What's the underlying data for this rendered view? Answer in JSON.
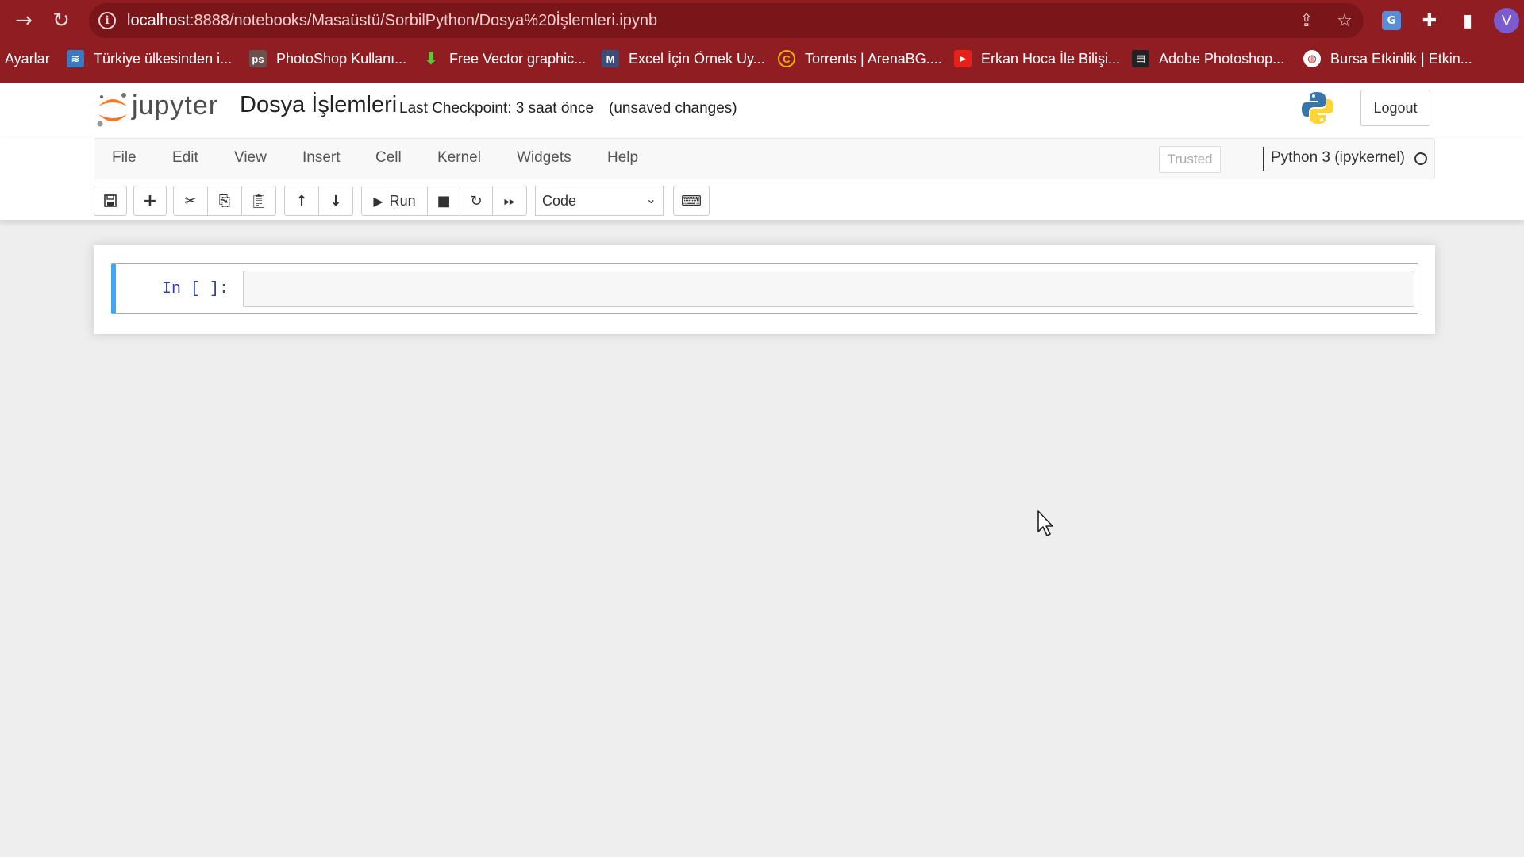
{
  "browser": {
    "url_host": "localhost",
    "url_path": ":8888/notebooks/Masaüstü/SorbilPython/Dosya%20İşlemleri.ipynb",
    "profile_initial": "V",
    "bookmarks": [
      {
        "label": "Ayarlar",
        "icon": "none"
      },
      {
        "label": "Türkiye ülkesinden i...",
        "icon": "map-icon"
      },
      {
        "label": "PhotoShop Kullanı...",
        "icon": "photoshop-icon"
      },
      {
        "label": "Free Vector graphic...",
        "icon": "download-arrow-icon"
      },
      {
        "label": "Excel İçin Örnek Uy...",
        "icon": "excel-icon"
      },
      {
        "label": "Torrents | ArenaBG....",
        "icon": "arenabg-icon"
      },
      {
        "label": "Erkan Hoca İle Bilişi...",
        "icon": "youtube-icon"
      },
      {
        "label": "Adobe Photoshop...",
        "icon": "bag-icon"
      },
      {
        "label": "Bursa Etkinlik | Etkin...",
        "icon": "globe-icon"
      }
    ],
    "colors": {
      "chrome_bg": "#8f1d22",
      "omnibox_bg": "#7a151a"
    }
  },
  "header": {
    "logo_text": "jupyter",
    "notebook_title": "Dosya İşlemleri",
    "checkpoint": "Last Checkpoint: 3 saat önce",
    "save_status": "(unsaved changes)",
    "logout_label": "Logout"
  },
  "menubar": {
    "items": [
      "File",
      "Edit",
      "View",
      "Insert",
      "Cell",
      "Kernel",
      "Widgets",
      "Help"
    ],
    "trusted_label": "Trusted",
    "kernel_name": "Python 3 (ipykernel)"
  },
  "toolbar": {
    "run_label": "Run",
    "cell_type": "Code"
  },
  "cells": [
    {
      "prompt": "In [ ]:",
      "source": ""
    }
  ],
  "colors": {
    "accent_selected_cell": "#42a5f5",
    "prompt_color": "#303f9f"
  }
}
